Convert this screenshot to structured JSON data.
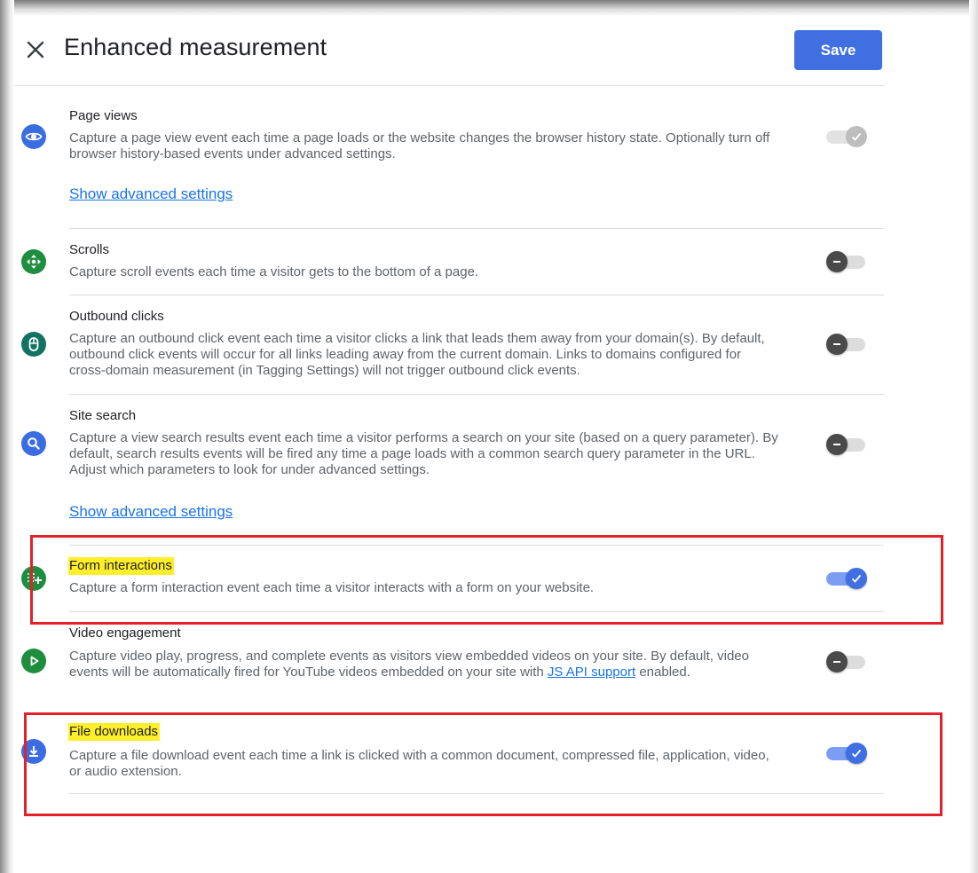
{
  "header": {
    "title": "Enhanced measurement",
    "save_label": "Save",
    "close_icon": "close-icon"
  },
  "colors": {
    "accent": "#3f6fe0",
    "link": "#1a73e8",
    "highlight": "#ffef2a",
    "annotation_border": "#e4202a",
    "icon_blue": "#3b6de2",
    "icon_green": "#1e8e3e",
    "icon_teal": "#137333"
  },
  "rows": [
    {
      "id": "page-views",
      "title": "Page views",
      "description": "Capture a page view event each time a page loads or the website changes the browser history state. Optionally turn off browser history-based events under advanced settings.",
      "advanced_link": "Show advanced settings",
      "icon": "eye-icon",
      "toggle_state": "on-disabled"
    },
    {
      "id": "scrolls",
      "title": "Scrolls",
      "description": "Capture scroll events each time a visitor gets to the bottom of a page.",
      "icon": "scroll-arrows-icon",
      "toggle_state": "off"
    },
    {
      "id": "outbound-clicks",
      "title": "Outbound clicks",
      "description": "Capture an outbound click event each time a visitor clicks a link that leads them away from your domain(s). By default, outbound click events will occur for all links leading away from the current domain. Links to domains configured for cross-domain measurement (in Tagging Settings) will not trigger outbound click events.",
      "icon": "mouse-icon",
      "toggle_state": "off"
    },
    {
      "id": "site-search",
      "title": "Site search",
      "description": "Capture a view search results event each time a visitor performs a search on your site (based on a query parameter). By default, search results events will be fired any time a page loads with a common search query parameter in the URL. Adjust which parameters to look for under advanced settings.",
      "advanced_link": "Show advanced settings",
      "icon": "search-icon",
      "toggle_state": "off"
    },
    {
      "id": "form-interactions",
      "title": "Form interactions",
      "description": "Capture a form interaction event each time a visitor interacts with a form on your website.",
      "icon": "form-add-icon",
      "toggle_state": "on",
      "highlighted": true
    },
    {
      "id": "video-engagement",
      "title": "Video engagement",
      "description_before_link": "Capture video play, progress, and complete events as visitors view embedded videos on your site. By default, video events will be automatically fired for YouTube videos embedded on your site with ",
      "description_link": "JS API support",
      "description_after_link": " enabled.",
      "icon": "play-icon",
      "toggle_state": "off"
    },
    {
      "id": "file-downloads",
      "title": "File downloads",
      "description": "Capture a file download event each time a link is clicked with a common document, compressed file, application, video, or audio extension.",
      "icon": "download-icon",
      "toggle_state": "on",
      "highlighted": true
    }
  ]
}
